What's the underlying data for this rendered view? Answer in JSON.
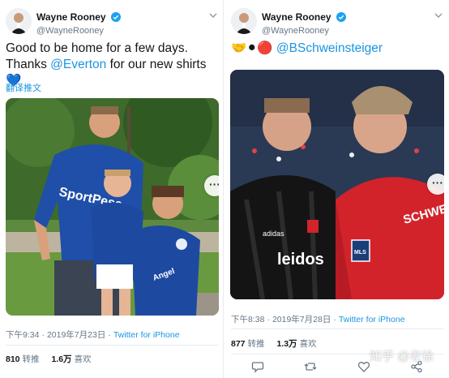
{
  "left_tweet": {
    "display_name": "Wayne Rooney",
    "handle": "@WayneRooney",
    "text_part1": "Good to be home for a few days. Thanks ",
    "mention": "@Everton",
    "text_part2": " for our new shirts ",
    "heart_emoji": "💙",
    "translate_label": "翻译推文",
    "time": "下午9:34",
    "dot": "·",
    "date": "2019年7月23日",
    "source": "Twitter for iPhone",
    "retweets_count": "810",
    "retweets_label": "转推",
    "likes_count": "1.6万",
    "likes_label": "喜欢",
    "more_label": "···",
    "photo": {
      "sky_color": "#d9e6ec",
      "foliage_color": "#3e6a2b",
      "jersey_color": "#1f4fa8",
      "sponsor_text": "SportPesa",
      "kid_shirt_text": "Angel"
    }
  },
  "right_tweet": {
    "display_name": "Wayne Rooney",
    "handle": "@WayneRooney",
    "emoji_text": "🤝⚫🔴",
    "mention": "@BSchweinsteiger",
    "time": "下午8:38",
    "dot": "·",
    "date": "2019年7月28日",
    "source": "Twitter for iPhone",
    "retweets_count": "877",
    "retweets_label": "转推",
    "likes_count": "1.3万",
    "likes_label": "喜欢",
    "more_label": "···",
    "photo": {
      "left_jersey_color": "#141414",
      "right_jersey_color": "#d2232a",
      "sponsor_text": "leidos",
      "brand_text": "adidas",
      "name_text": "SCHWEI",
      "badge_text": "MLS"
    }
  },
  "watermark": "知乎 @老徐",
  "colors": {
    "link": "#1b95e0",
    "verified": "#1da1f2",
    "muted": "#657786",
    "text": "#14171a"
  }
}
